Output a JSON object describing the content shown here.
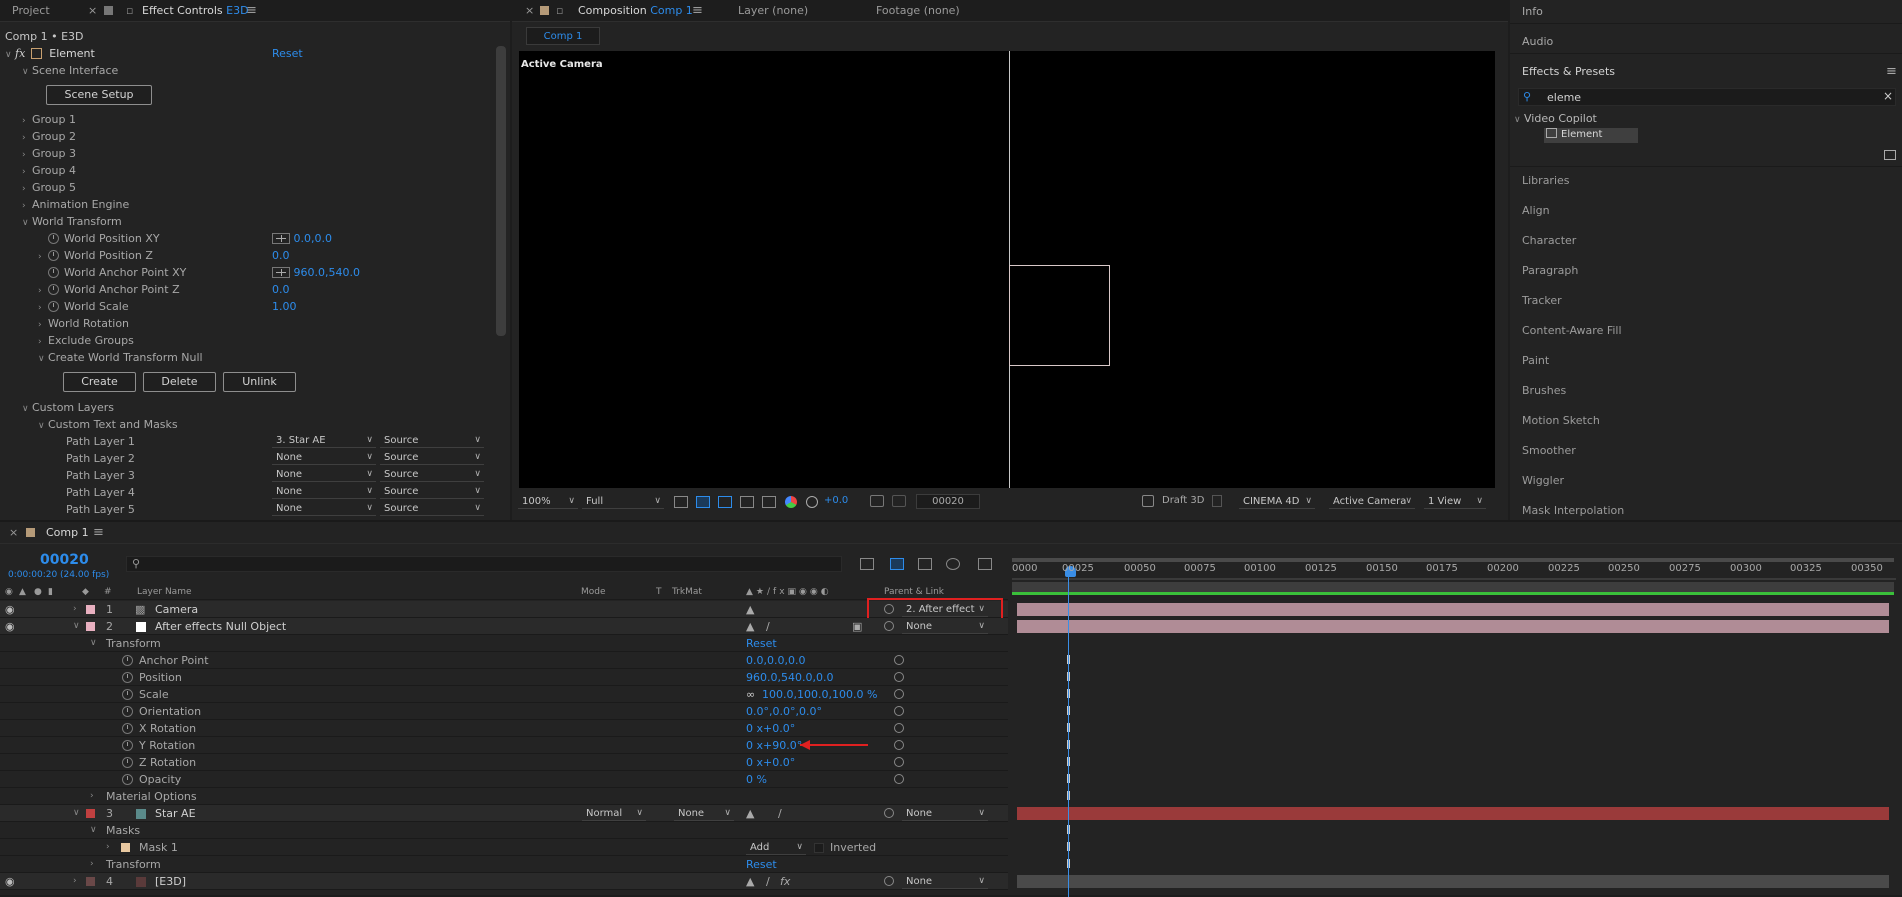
{
  "app": {
    "accent": "#2d8ceb",
    "playhead_color": "#3a8ee6",
    "annotation_color": "#e02020"
  },
  "left_tabs": {
    "project": "Project",
    "effect_controls": "Effect Controls",
    "e3d": "E3D",
    "menu": "≡",
    "close": "×"
  },
  "effect_controls": {
    "breadcrumb": "Comp 1 • E3D",
    "fx_label": "fx",
    "effect_name": "Element",
    "reset": "Reset",
    "scene_interface": "Scene Interface",
    "scene_setup": "Scene Setup",
    "groups": [
      "Group 1",
      "Group 2",
      "Group 3",
      "Group 4",
      "Group 5"
    ],
    "animation_engine": "Animation Engine",
    "world_transform": "World Transform",
    "props": [
      {
        "label": "World Position XY",
        "value": "0.0,0.0",
        "crosshair": true
      },
      {
        "label": "World Position Z",
        "value": "0.0",
        "crosshair": false
      },
      {
        "label": "World Anchor Point XY",
        "value": "960.0,540.0",
        "crosshair": true
      },
      {
        "label": "World Anchor Point Z",
        "value": "0.0",
        "crosshair": false
      },
      {
        "label": "World Scale",
        "value": "1.00",
        "crosshair": false
      }
    ],
    "world_rotation": "World Rotation",
    "exclude_groups": "Exclude Groups",
    "create_null": "Create World Transform Null",
    "buttons": {
      "create": "Create",
      "delete": "Delete",
      "unlink": "Unlink"
    },
    "custom_layers": "Custom Layers",
    "custom_text_masks": "Custom Text and Masks",
    "path_layers": [
      {
        "label": "Path Layer 1",
        "layer": "3. Star AE",
        "src": "Source"
      },
      {
        "label": "Path Layer 2",
        "layer": "None",
        "src": "Source"
      },
      {
        "label": "Path Layer 3",
        "layer": "None",
        "src": "Source"
      },
      {
        "label": "Path Layer 4",
        "layer": "None",
        "src": "Source"
      },
      {
        "label": "Path Layer 5",
        "layer": "None",
        "src": "Source"
      }
    ]
  },
  "comp_tabs": {
    "composition": "Composition",
    "comp_name": "Comp 1",
    "layer": "Layer (none)",
    "footage": "Footage (none)",
    "subtab": "Comp 1"
  },
  "viewer": {
    "label": "Active Camera",
    "zoom": "100%",
    "resolution": "Full",
    "exposure": "+0.0",
    "timecode": "00020",
    "renderer_label": "Draft 3D",
    "renderer": "CINEMA 4D",
    "camera": "Active Camera",
    "views": "1 View"
  },
  "right_panel": {
    "info": "Info",
    "audio": "Audio",
    "effects_presets": "Effects & Presets",
    "search": "eleme",
    "category": "Video Copilot",
    "result": "Element",
    "items": [
      "Libraries",
      "Align",
      "Character",
      "Paragraph",
      "Tracker",
      "Content-Aware Fill",
      "Paint",
      "Brushes",
      "Motion Sketch",
      "Smoother",
      "Wiggler",
      "Mask Interpolation"
    ]
  },
  "timeline": {
    "tab": "Comp 1",
    "timecode": "00020",
    "timecode_sub": "0:00:00:20 (24.00 fps)",
    "headers": {
      "layer_name": "Layer Name",
      "mode": "Mode",
      "t": "T",
      "trkmat": "TrkMat",
      "parent": "Parent & Link",
      "num": "#"
    },
    "ruler": [
      "0000",
      "00025",
      "00050",
      "00075",
      "00100",
      "00125",
      "00150",
      "00175",
      "00200",
      "00225",
      "00250",
      "00275",
      "00300",
      "00325",
      "00350"
    ],
    "layers": [
      {
        "num": "1",
        "name": "Camera",
        "parent": "2. After effect",
        "color": "#e8b0c0"
      },
      {
        "num": "2",
        "name": "After effects Null Object",
        "parent": "None",
        "color": "#e8b0c0"
      },
      {
        "num": "3",
        "name": "Star AE",
        "mode": "Normal",
        "trkmat": "None",
        "parent": "None",
        "color": "#c04040"
      },
      {
        "num": "4",
        "name": "[E3D]",
        "parent": "None",
        "color": "#6a4848"
      }
    ],
    "transform": "Transform",
    "reset": "Reset",
    "transform_props": [
      {
        "label": "Anchor Point",
        "value": "0.0,0.0,0.0"
      },
      {
        "label": "Position",
        "value": "960.0,540.0,0.0"
      },
      {
        "label": "Scale",
        "value": "100.0,100.0,100.0 %"
      },
      {
        "label": "Orientation",
        "value": "0.0°,0.0°,0.0°"
      },
      {
        "label": "X Rotation",
        "value": "0 x+0.0°"
      },
      {
        "label": "Y Rotation",
        "value": "0 x+90.0°"
      },
      {
        "label": "Z Rotation",
        "value": "0 x+0.0°"
      },
      {
        "label": "Opacity",
        "value": "0 %"
      }
    ],
    "material_options": "Material Options",
    "masks": "Masks",
    "mask1": "Mask 1",
    "mask_mode": "Add",
    "inverted": "Inverted"
  }
}
